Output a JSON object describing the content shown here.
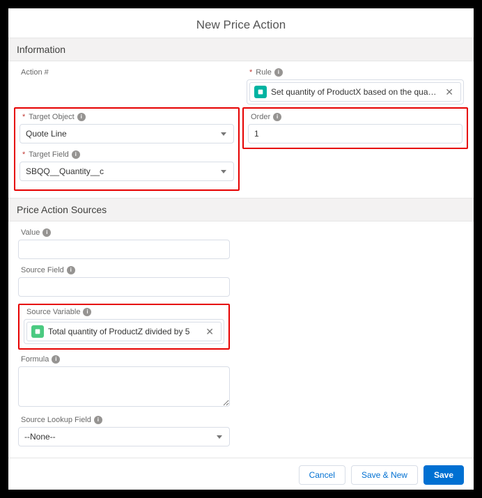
{
  "header": {
    "title": "New Price Action"
  },
  "sections": {
    "information": "Information",
    "sources": "Price Action Sources"
  },
  "fields": {
    "action_num": {
      "label": "Action #"
    },
    "rule": {
      "label": "Rule",
      "pill_text": "Set quantity of ProductX based on the quan…"
    },
    "target_object": {
      "label": "Target Object",
      "value": "Quote Line"
    },
    "order": {
      "label": "Order",
      "value": "1"
    },
    "target_field": {
      "label": "Target Field",
      "value": "SBQQ__Quantity__c"
    },
    "value": {
      "label": "Value"
    },
    "source_field": {
      "label": "Source Field"
    },
    "source_variable": {
      "label": "Source Variable",
      "pill_text": "Total quantity of ProductZ divided by 5"
    },
    "formula": {
      "label": "Formula"
    },
    "source_lookup": {
      "label": "Source Lookup Field",
      "value": "--None--"
    }
  },
  "footer": {
    "cancel": "Cancel",
    "save_new": "Save & New",
    "save": "Save"
  }
}
